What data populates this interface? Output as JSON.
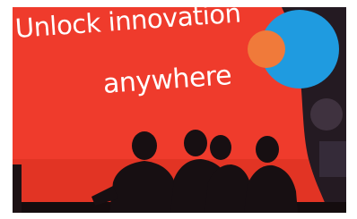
{
  "headline": {
    "line1": "Unlock innovation",
    "line2": "anywhere"
  },
  "colors": {
    "screen_red": "#ef3b2c",
    "circle_orange": "#f07a3a",
    "circle_blue": "#1f9be0",
    "background_dark": "#1a0c10",
    "silhouette": "#170f12"
  },
  "scene": {
    "subject": "people-silhouettes",
    "people_count": 4
  }
}
